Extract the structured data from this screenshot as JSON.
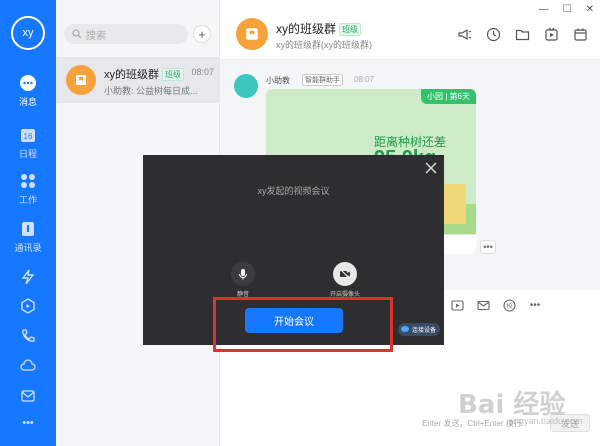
{
  "me": {
    "avatar_text": "xy"
  },
  "rail": [
    {
      "label": "消息",
      "icon": "chat-bubble-icon",
      "active": true
    },
    {
      "label": "日程",
      "icon": "calendar-icon",
      "day": "16"
    },
    {
      "label": "工作",
      "icon": "grid-apps-icon"
    },
    {
      "label": "通讯录",
      "icon": "contacts-icon"
    },
    {
      "label": "",
      "icon": "lightning-icon"
    },
    {
      "label": "",
      "icon": "hexagon-icon"
    },
    {
      "label": "",
      "icon": "phone-icon"
    },
    {
      "label": "",
      "icon": "cloud-icon"
    },
    {
      "label": "",
      "icon": "mail-icon"
    },
    {
      "label": "•••",
      "icon": "more-icon"
    }
  ],
  "conversation_list": {
    "search_placeholder": "搜索",
    "items": [
      {
        "name": "xy的班级群",
        "tag": "班级",
        "time": "08:07",
        "preview": "小助教: 公益树每日成..."
      }
    ]
  },
  "chat": {
    "title": "xy的班级群",
    "tag": "班级",
    "subtitle": "xy的班级群(xy的班级群)",
    "message": {
      "sender": "小助教",
      "sender_tag": "智能群助手",
      "time": "08:07",
      "card_badge": "小园 | 第6天",
      "card_line1": "距离种树还差",
      "card_line2": "95.0kg"
    },
    "send_hint": "Enter 发送，Ctrl+Enter 换行",
    "send_label": "发送"
  },
  "meeting_modal": {
    "title": "xy发起的视频会议",
    "mic_label": "静音",
    "camera_label": "开启摄像头",
    "start_label": "开始会议",
    "device_label": "连接设备"
  },
  "watermark": {
    "main": "Bai 经验",
    "sub": "jingyan.baidu.com"
  },
  "colors": {
    "accent": "#1677ff",
    "modal_bg": "#2e2e30",
    "highlight": "#e03131"
  }
}
